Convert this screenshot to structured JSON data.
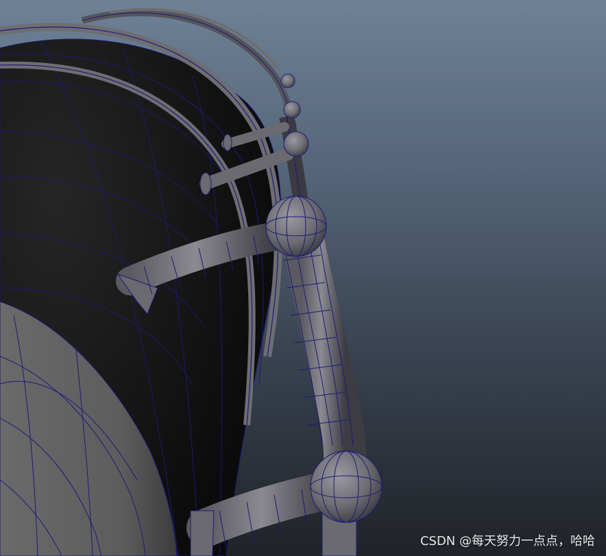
{
  "scene": {
    "description_icon": "3d-viewport-drum-wireframe",
    "colors": {
      "background_top": "#6f8196",
      "background_bottom": "#202328",
      "drum_body": "#151515",
      "hoop_gray": "#6e6e72",
      "wire": "#1c1a7a"
    }
  },
  "watermark": {
    "text": "CSDN @每天努力一点点，哈哈"
  }
}
